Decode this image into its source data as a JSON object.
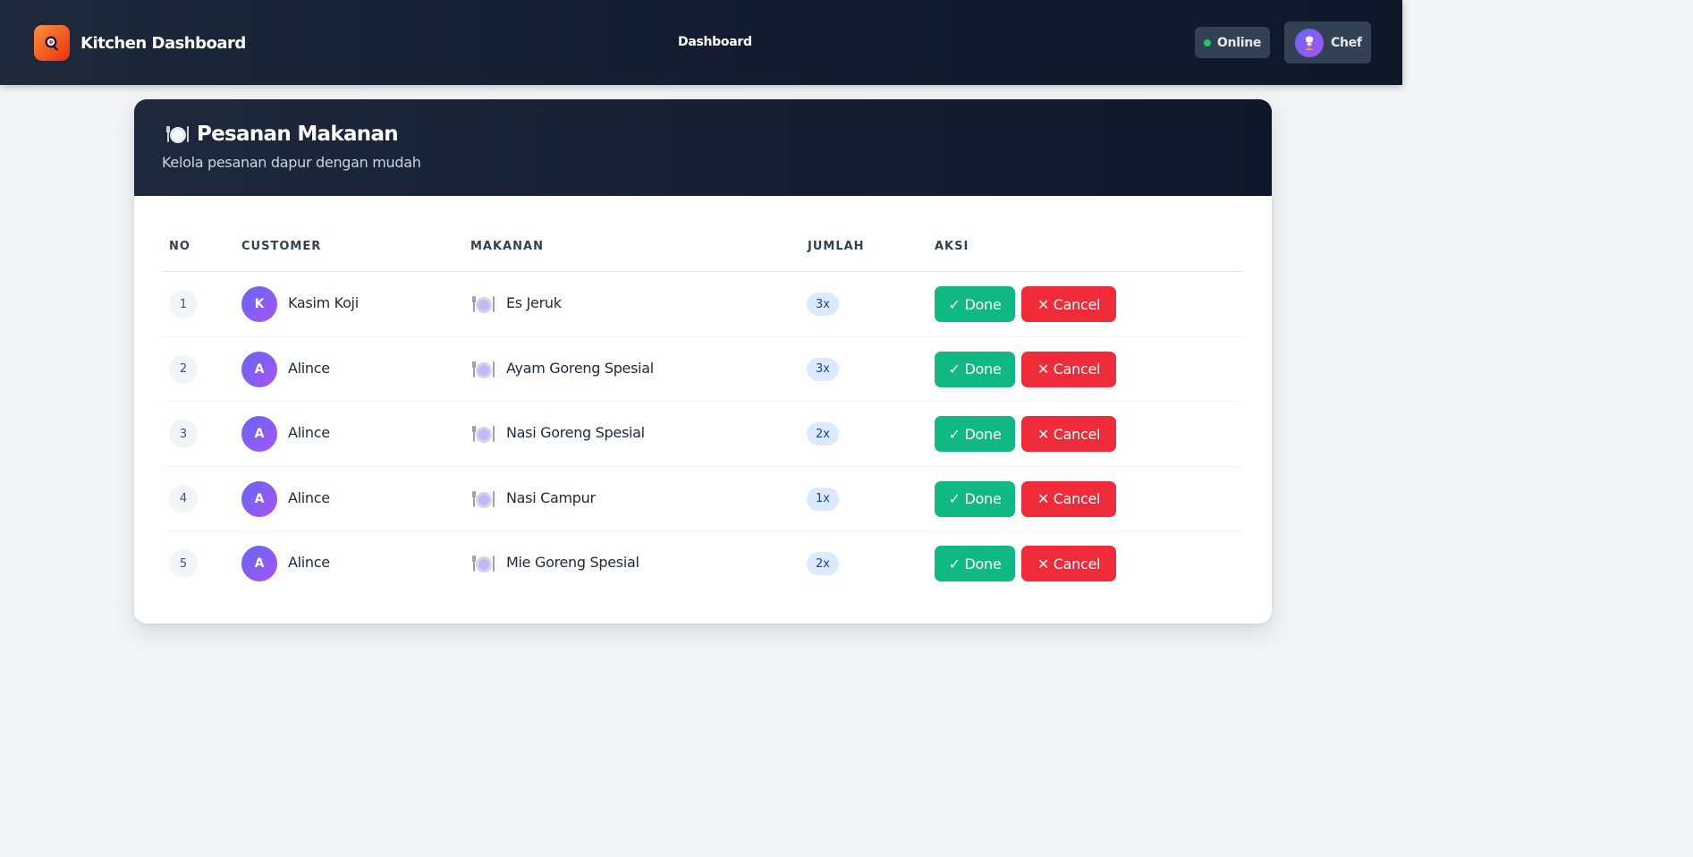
{
  "navbar": {
    "brand_title": "Kitchen Dashboard",
    "brand_icon": "search-bowl-icon",
    "nav_link": "Dashboard",
    "status": "Online",
    "status_color": "#22c55e",
    "user_name": "Chef",
    "user_icon": "chef-icon"
  },
  "card": {
    "title": "Pesanan Makanan",
    "title_icon": "plate-icon",
    "subtitle": "Kelola pesanan dapur dengan mudah"
  },
  "table": {
    "headers": {
      "no": "NO",
      "customer": "CUSTOMER",
      "food": "MAKANAN",
      "qty": "JUMLAH",
      "action": "AKSI"
    },
    "rows": [
      {
        "no": "1",
        "initial": "K",
        "customer": "Kasim Koji",
        "food": "Es Jeruk",
        "qty": "3x"
      },
      {
        "no": "2",
        "initial": "A",
        "customer": "Alince",
        "food": "Ayam Goreng Spesial",
        "qty": "3x"
      },
      {
        "no": "3",
        "initial": "A",
        "customer": "Alince",
        "food": "Nasi Goreng Spesial",
        "qty": "2x"
      },
      {
        "no": "4",
        "initial": "A",
        "customer": "Alince",
        "food": "Nasi Campur",
        "qty": "1x"
      },
      {
        "no": "5",
        "initial": "A",
        "customer": "Alince",
        "food": "Mie Goreng Spesial",
        "qty": "2x"
      }
    ],
    "done_label": "✓ Done",
    "cancel_label": "✕ Cancel"
  },
  "colors": {
    "done": "#10b981",
    "cancel": "#ef2b3a",
    "navbar": "#1e293b",
    "avatar_gradient_start": "#6366f1",
    "avatar_gradient_end": "#a855f7"
  }
}
